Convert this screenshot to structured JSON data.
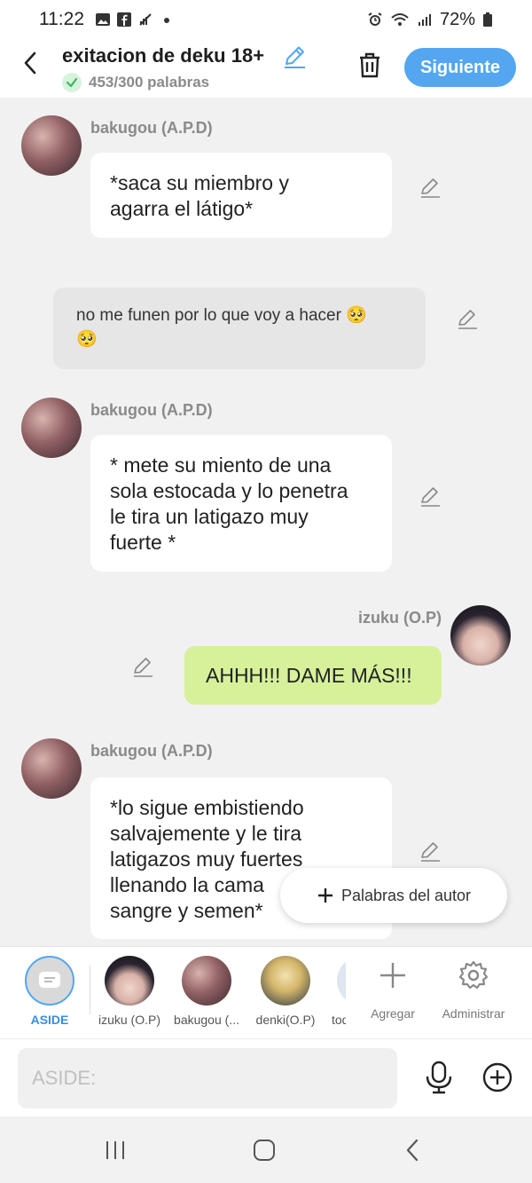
{
  "status_bar": {
    "time": "11:22",
    "battery": "72%",
    "icons": [
      "image-icon",
      "facebook-icon",
      "mute-icon",
      "dot-icon",
      "alarm-icon",
      "wifi-icon",
      "signal-icon",
      "battery-icon"
    ]
  },
  "header": {
    "title": "exitacion de deku 18+",
    "word_count": "453/300 palabras",
    "next_label": "Siguiente"
  },
  "messages": [
    {
      "type": "character",
      "side": "left",
      "author": "bakugou (A.P.D)",
      "lines": [
        "*saca su miembro y",
        "agarra el látigo*"
      ]
    },
    {
      "type": "narration",
      "lines": [
        "no me funen por lo que voy a hacer 🥺",
        "🥺"
      ]
    },
    {
      "type": "character",
      "side": "left",
      "author": "bakugou (A.P.D)",
      "lines": [
        "* mete su miento de una",
        "sola estocada y lo penetra",
        "le tira un latigazo muy",
        "fuerte *"
      ]
    },
    {
      "type": "character",
      "side": "right",
      "author": "izuku (O.P)",
      "lines": [
        "AHHH!!! DAME MÁS!!!"
      ]
    },
    {
      "type": "character",
      "side": "left",
      "author": "bakugou (A.P.D)",
      "lines": [
        "*lo sigue embistiendo",
        "salvajemente y le tira",
        "latigazos muy fuertes",
        "llenando la cama",
        "sangre y semen*"
      ]
    }
  ],
  "author_words_button": "Palabras del autor",
  "characters": [
    {
      "label": "ASIDE",
      "selected": true
    },
    {
      "label": "izuku (O.P)"
    },
    {
      "label": "bakugou (..."
    },
    {
      "label": "denki(O.P)"
    },
    {
      "label": "tod"
    }
  ],
  "tools": {
    "add_label": "Agregar",
    "manage_label": "Administrar"
  },
  "input": {
    "placeholder": "ASIDE:"
  },
  "colors": {
    "accent": "#53a6ef",
    "green_bubble": "#d6f19a",
    "background": "#f1f1f1",
    "check_green": "#3cb85a"
  }
}
